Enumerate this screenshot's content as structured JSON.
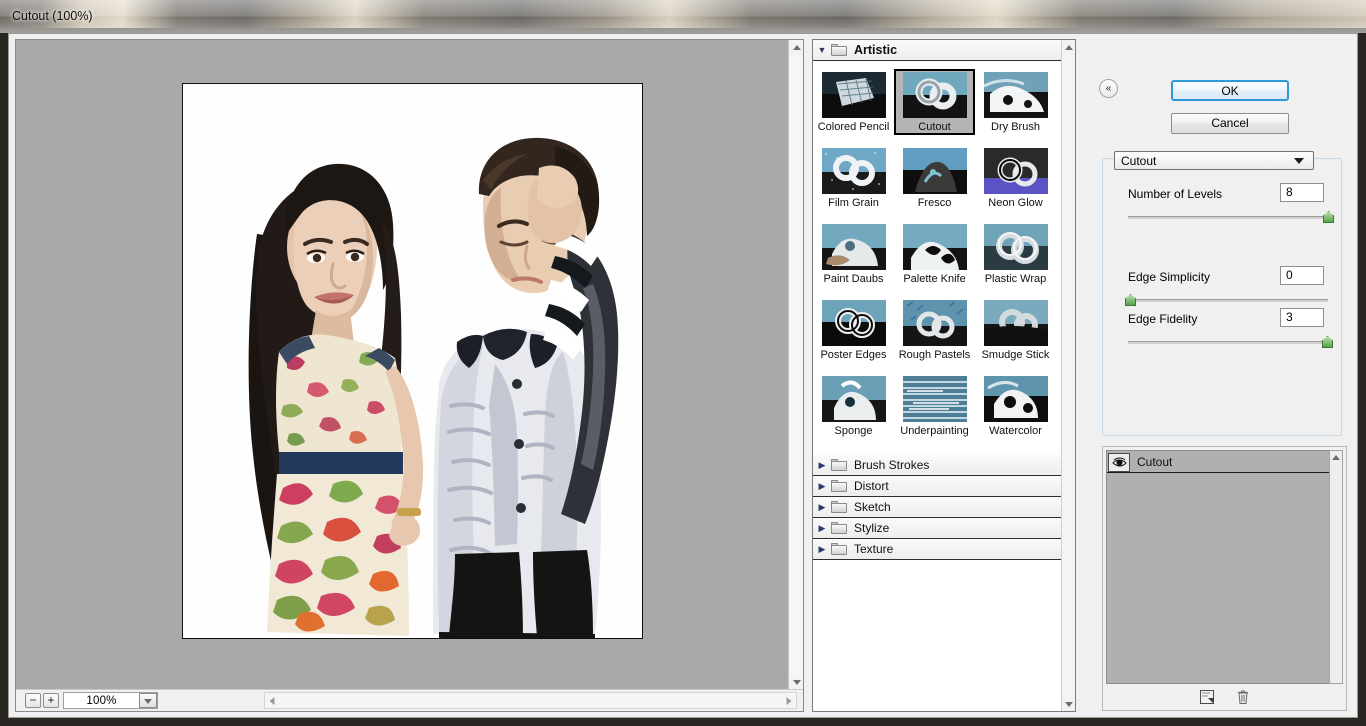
{
  "window": {
    "title": "Cutout (100%)"
  },
  "preview": {
    "zoom_out_label": "−",
    "zoom_in_label": "+",
    "zoom_value": "100%",
    "zoom_dropdown_icon": "chevron-down-icon",
    "image_alt": "filtered photo of a woman in a floral dress and a man in a varsity jacket"
  },
  "gallery": {
    "categories": [
      {
        "name": "Artistic",
        "expanded": true,
        "arrow_glyph": "▼",
        "filters": [
          {
            "label": "Colored Pencil",
            "selected": false
          },
          {
            "label": "Cutout",
            "selected": true
          },
          {
            "label": "Dry Brush",
            "selected": false
          },
          {
            "label": "Film Grain",
            "selected": false
          },
          {
            "label": "Fresco",
            "selected": false
          },
          {
            "label": "Neon Glow",
            "selected": false
          },
          {
            "label": "Paint Daubs",
            "selected": false
          },
          {
            "label": "Palette Knife",
            "selected": false
          },
          {
            "label": "Plastic Wrap",
            "selected": false
          },
          {
            "label": "Poster Edges",
            "selected": false
          },
          {
            "label": "Rough Pastels",
            "selected": false
          },
          {
            "label": "Smudge Stick",
            "selected": false
          },
          {
            "label": "Sponge",
            "selected": false
          },
          {
            "label": "Underpainting",
            "selected": false
          },
          {
            "label": "Watercolor",
            "selected": false
          }
        ]
      },
      {
        "name": "Brush Strokes",
        "expanded": false,
        "arrow_glyph": "▶",
        "filters": []
      },
      {
        "name": "Distort",
        "expanded": false,
        "arrow_glyph": "▶",
        "filters": []
      },
      {
        "name": "Sketch",
        "expanded": false,
        "arrow_glyph": "▶",
        "filters": []
      },
      {
        "name": "Stylize",
        "expanded": false,
        "arrow_glyph": "▶",
        "filters": []
      },
      {
        "name": "Texture",
        "expanded": false,
        "arrow_glyph": "▶",
        "filters": []
      }
    ]
  },
  "right_panel": {
    "collapse_glyph": "«",
    "ok_label": "OK",
    "cancel_label": "Cancel",
    "filter_select_value": "Cutout",
    "settings": [
      {
        "label": "Number of Levels",
        "value": "8",
        "min": 2,
        "max": 8,
        "percent": 100
      },
      {
        "label": "Edge Simplicity",
        "value": "0",
        "min": 0,
        "max": 10,
        "percent": 0
      },
      {
        "label": "Edge Fidelity",
        "value": "3",
        "min": 1,
        "max": 3,
        "percent": 100
      }
    ],
    "effects": {
      "layers": [
        {
          "name": "Cutout",
          "visible": true,
          "selected": true
        }
      ],
      "new_layer_icon": "new-effect-layer-icon",
      "delete_icon": "trash-icon"
    }
  },
  "accent_colors": {
    "ok_border": "#2e9ada",
    "slider_knob": "#58a24a",
    "selected_thumb_bg": "#b4b4b4",
    "effects_list_bg": "#b0b0b0"
  }
}
